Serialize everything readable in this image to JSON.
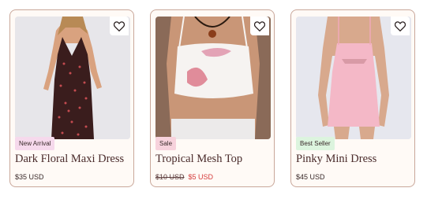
{
  "products": [
    {
      "badge": "New Arrival",
      "title": "Dark Floral Maxi Dress",
      "price": "$35 USD",
      "favorite_icon": "heart-icon",
      "badge_color": "#f6d9ec"
    },
    {
      "badge": "Sale",
      "title": "Tropical Mesh Top",
      "original_price": "$10 USD",
      "sale_price": "$5 USD",
      "favorite_icon": "heart-icon",
      "badge_color": "#f7d2dc",
      "sale_color": "#d53b3b"
    },
    {
      "badge": "Best Seller",
      "title": "Pinky Mini Dress",
      "price": "$45 USD",
      "favorite_icon": "heart-icon",
      "badge_color": "#dcf4de"
    }
  ]
}
